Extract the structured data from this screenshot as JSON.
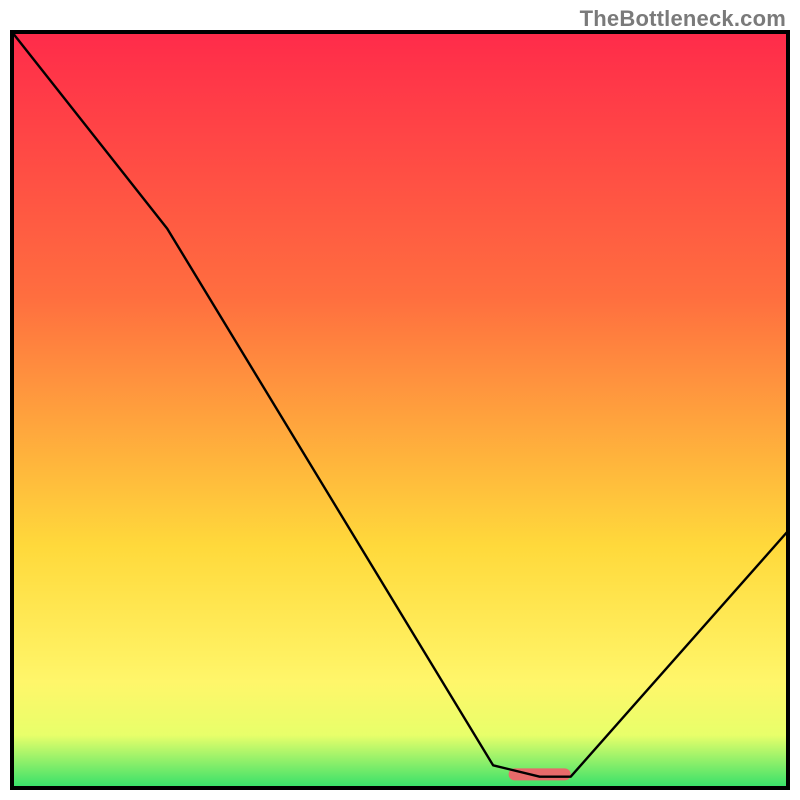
{
  "watermark": "TheBottleneck.com",
  "colors": {
    "top": "#ff2b4a",
    "mid1": "#ff6e3f",
    "mid2": "#ffd93b",
    "low1": "#fff66a",
    "low2": "#e8ff6a",
    "bottom": "#34e06a",
    "marker": "#e86a6a",
    "curve": "#000000",
    "border": "#000000"
  },
  "chart_data": {
    "type": "line",
    "title": "",
    "xlabel": "",
    "ylabel": "",
    "xlim": [
      0,
      100
    ],
    "ylim": [
      0,
      100
    ],
    "series": [
      {
        "name": "bottleneck-curve",
        "x": [
          0,
          20,
          62,
          68,
          72,
          100
        ],
        "values": [
          100,
          74,
          3,
          1.5,
          1.5,
          34
        ]
      }
    ],
    "marker": {
      "x_start": 64,
      "x_end": 72,
      "y": 1.8
    },
    "gradient_stops": [
      {
        "pct": 0,
        "key": "top"
      },
      {
        "pct": 35,
        "key": "mid1"
      },
      {
        "pct": 68,
        "key": "mid2"
      },
      {
        "pct": 86,
        "key": "low1"
      },
      {
        "pct": 93,
        "key": "low2"
      },
      {
        "pct": 100,
        "key": "bottom"
      }
    ]
  }
}
